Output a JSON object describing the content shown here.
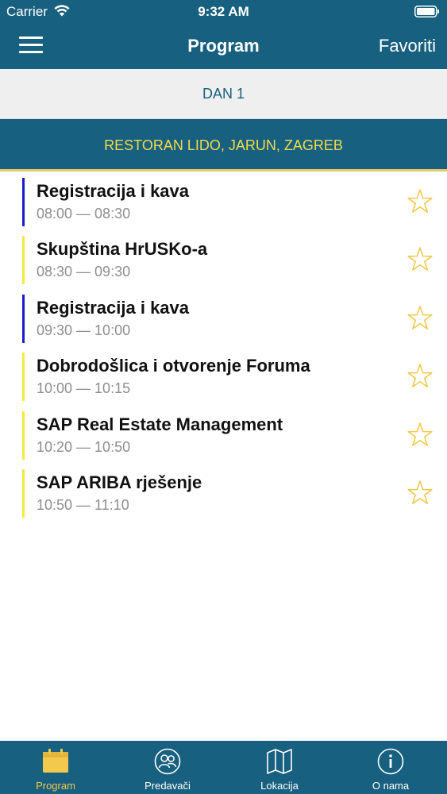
{
  "status_bar": {
    "carrier": "Carrier",
    "time": "9:32 AM"
  },
  "nav_bar": {
    "menu_icon": "hamburger-menu-icon",
    "title": "Program",
    "right_button": "Favoriti"
  },
  "day_selector": {
    "label": "DAN 1"
  },
  "location": {
    "label": "RESTORAN LIDO, JARUN, ZAGREB"
  },
  "sessions": [
    {
      "title": "Registracija i kava",
      "time": "08:00 — 08:30",
      "accent": "#1c1ccc",
      "favorite_icon": "star-outline-icon"
    },
    {
      "title": "Skupština HrUSKo-a",
      "time": "08:30 — 09:30",
      "accent": "#f5ea3c",
      "favorite_icon": "star-outline-icon"
    },
    {
      "title": "Registracija i kava",
      "time": "09:30 — 10:00",
      "accent": "#1c1ccc",
      "favorite_icon": "star-outline-icon"
    },
    {
      "title": "Dobrodošlica i otvorenje Foruma",
      "time": "10:00 — 10:15",
      "accent": "#f5ea3c",
      "favorite_icon": "star-outline-icon"
    },
    {
      "title": "SAP Real Estate Management",
      "time": "10:20 — 10:50",
      "accent": "#f5ea3c",
      "favorite_icon": "star-outline-icon"
    },
    {
      "title": "SAP ARIBA rješenje",
      "time": "10:50 — 11:10",
      "accent": "#f5ea3c",
      "favorite_icon": "star-outline-icon"
    }
  ],
  "tab_bar": {
    "tabs": [
      {
        "label": "Program",
        "icon": "calendar-icon",
        "active": true
      },
      {
        "label": "Predavači",
        "icon": "speakers-icon",
        "active": false
      },
      {
        "label": "Lokacija",
        "icon": "map-icon",
        "active": false
      },
      {
        "label": "O nama",
        "icon": "info-icon",
        "active": false
      }
    ]
  },
  "colors": {
    "primary": "#17607f",
    "location_text": "#f2db4d",
    "star": "#f2c94c",
    "active_tab": "#f2c94c"
  }
}
